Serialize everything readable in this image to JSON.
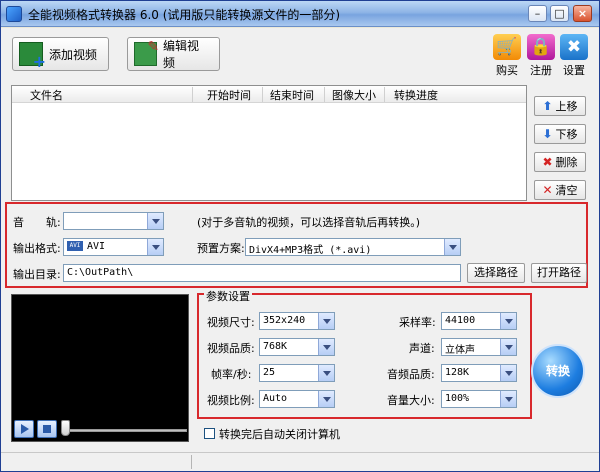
{
  "window": {
    "title": "全能视频格式转换器 6.0 (试用版只能转换源文件的一部分)",
    "minimize_glyph": "–",
    "maximize_glyph": "□",
    "close_glyph": "×"
  },
  "toolbar": {
    "add_video": "添加视频",
    "edit_video": "编辑视频",
    "buy": "购买",
    "register": "注册",
    "settings": "设置"
  },
  "file_list": {
    "columns": [
      "文件名",
      "开始时间",
      "结束时间",
      "图像大小",
      "转换进度"
    ]
  },
  "side_buttons": {
    "move_up": "上移",
    "move_down": "下移",
    "delete": "删除",
    "clear": "清空"
  },
  "output": {
    "audio_track_label": "音　　轨:",
    "audio_track_value": "",
    "audio_track_hint": "(对于多音轨的视频，可以选择音轨后再转换。)",
    "format_label": "输出格式:",
    "format_badge": "AVI",
    "format_value": "AVI",
    "preset_label": "预置方案:",
    "preset_value": "DivX4+MP3格式 (*.avi)",
    "dir_label": "输出目录:",
    "dir_value": "C:\\OutPath\\",
    "choose_path": "选择路径",
    "open_path": "打开路径"
  },
  "params": {
    "legend": "参数设置",
    "video_size_label": "视频尺寸:",
    "video_size_value": "352x240",
    "video_quality_label": "视频品质:",
    "video_quality_value": "768K",
    "fps_label": "帧率/秒:",
    "fps_value": "25",
    "aspect_label": "视频比例:",
    "aspect_value": "Auto",
    "sample_rate_label": "采样率:",
    "sample_rate_value": "44100",
    "channel_label": "声道:",
    "channel_value": "立体声",
    "audio_quality_label": "音频品质:",
    "audio_quality_value": "128K",
    "volume_label": "音量大小:",
    "volume_value": "100%"
  },
  "convert": {
    "label": "转换"
  },
  "shutdown_checkbox": {
    "label": "转换完后自动关闭计算机",
    "checked": false
  },
  "player": {
    "progress": 0
  }
}
